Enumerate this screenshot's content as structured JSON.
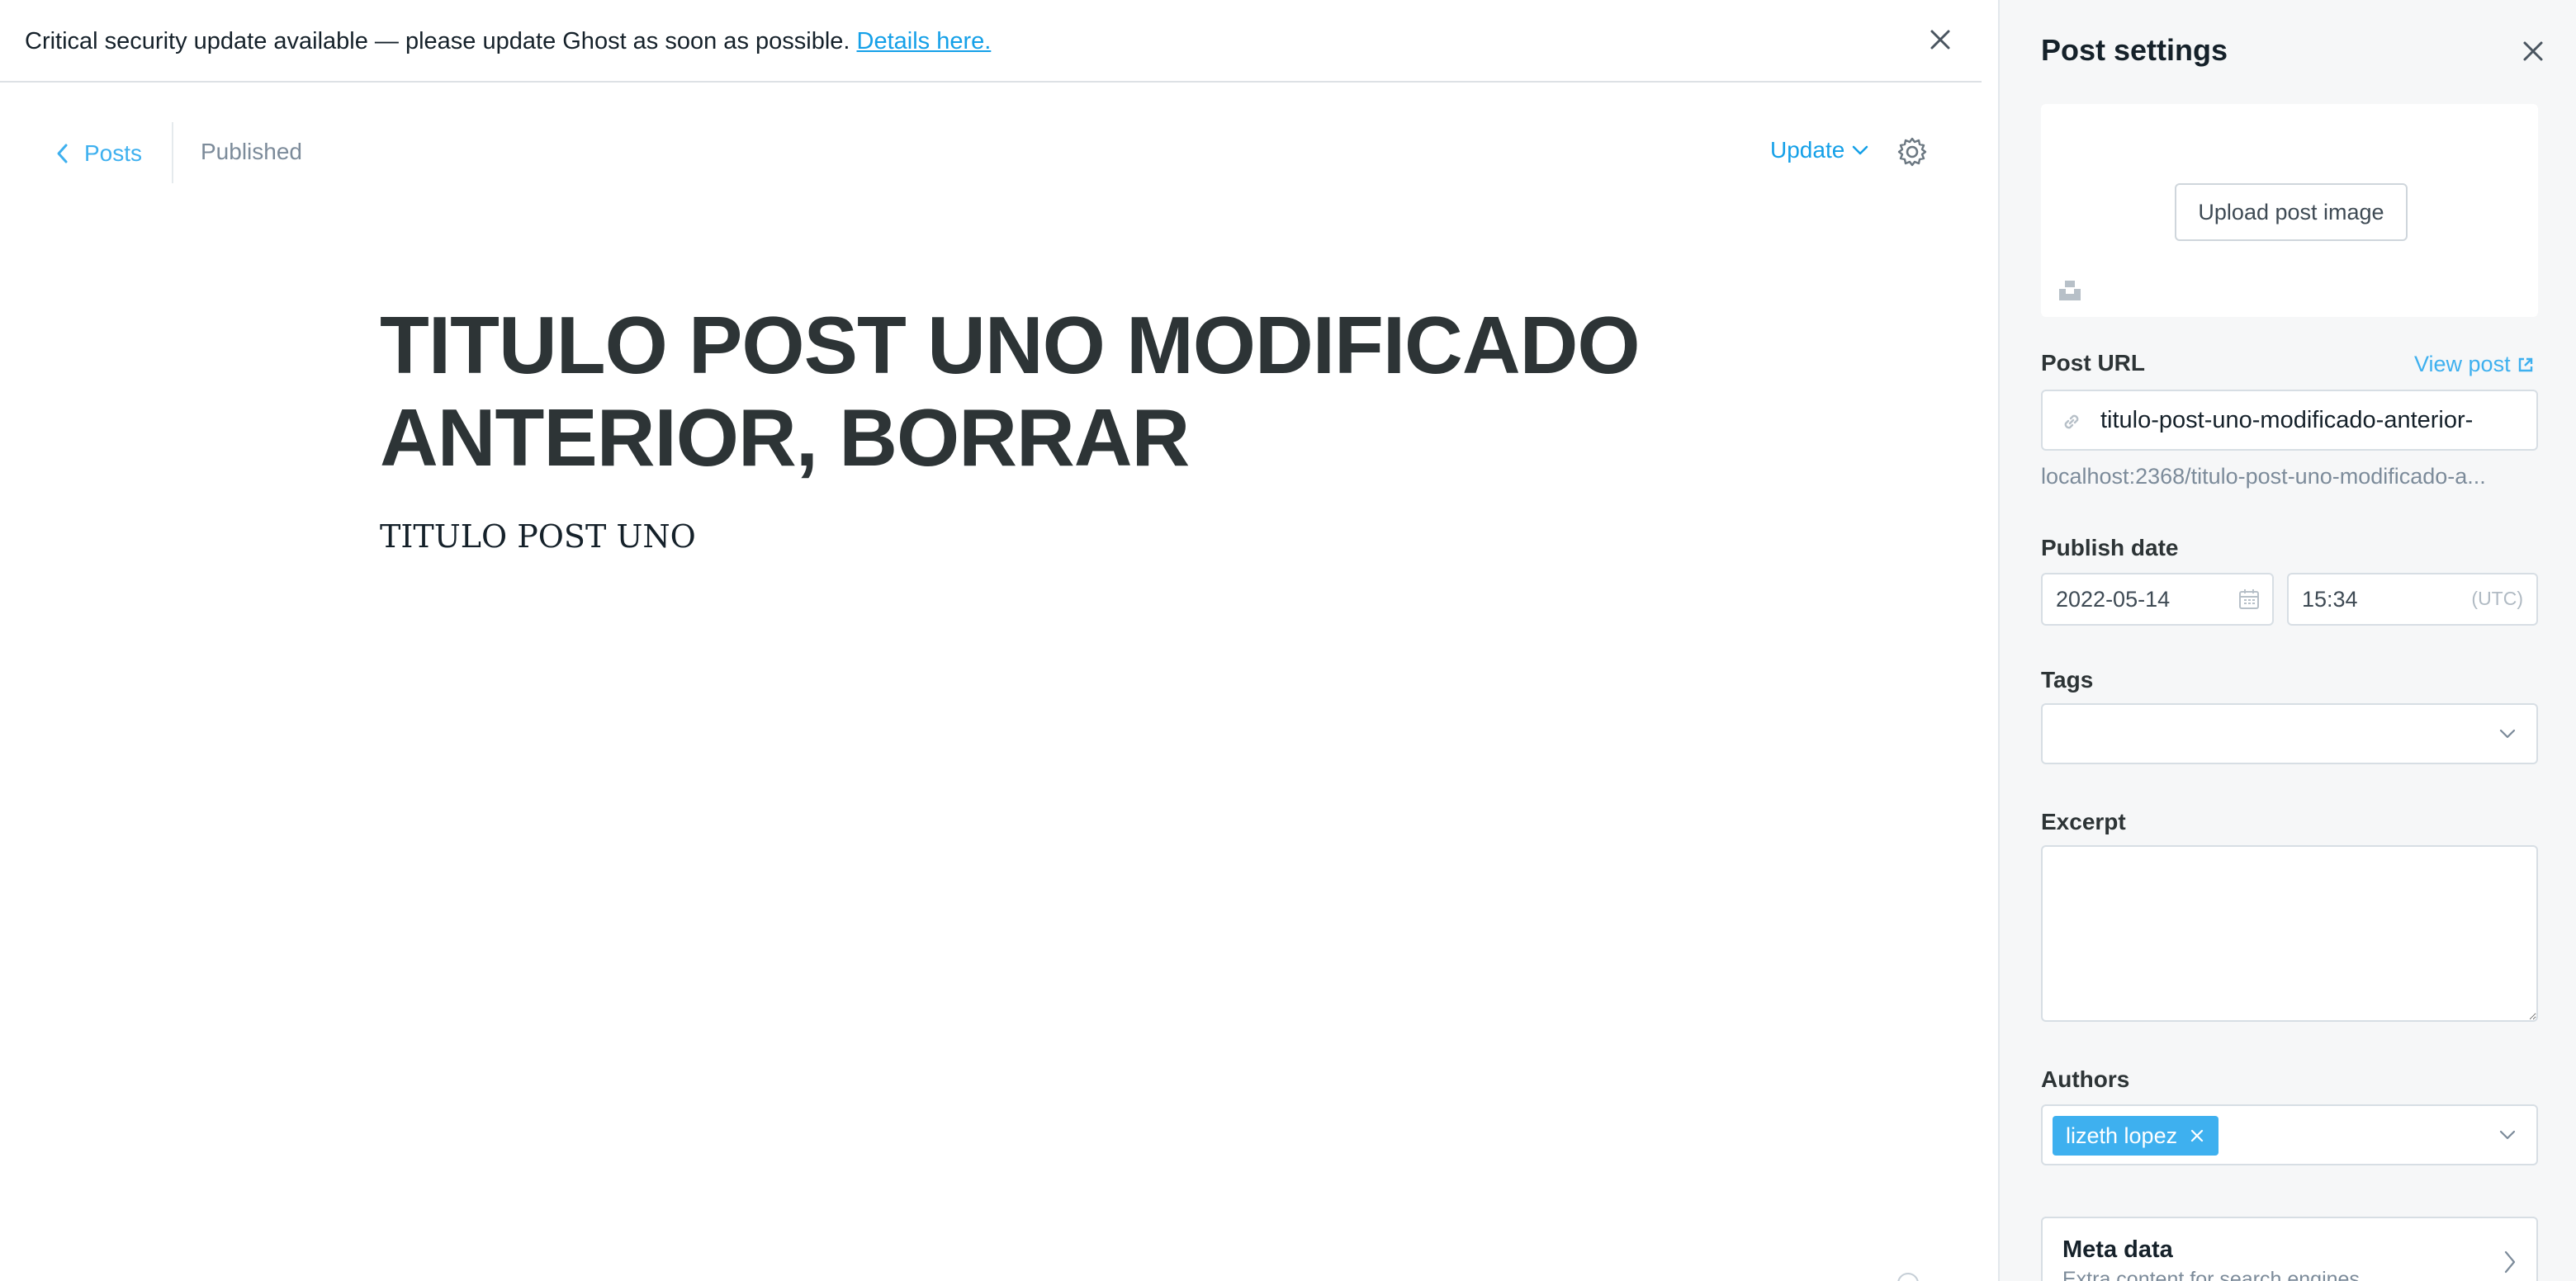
{
  "alert": {
    "message": "Critical security update available — please update Ghost as soon as possible.",
    "link_text": "Details here."
  },
  "nav": {
    "back_label": "Posts",
    "status": "Published",
    "update_label": "Update"
  },
  "post": {
    "title": "TITULO POST UNO MODIFICADO ANTERIOR, BORRAR",
    "body": "TITULO POST UNO"
  },
  "settings": {
    "title": "Post settings",
    "upload_label": "Upload post image",
    "url": {
      "label": "Post URL",
      "view_link": "View post",
      "slug": "titulo-post-uno-modificado-anterior-",
      "full_url": "localhost:2368/titulo-post-uno-modificado-a..."
    },
    "publish_date": {
      "label": "Publish date",
      "date": "2022-05-14",
      "time": "15:34",
      "timezone": "(UTC)"
    },
    "tags": {
      "label": "Tags"
    },
    "excerpt": {
      "label": "Excerpt",
      "value": ""
    },
    "authors": {
      "label": "Authors",
      "items": [
        "lizeth lopez"
      ]
    },
    "meta": {
      "title": "Meta data",
      "subtitle": "Extra content for search engines"
    }
  },
  "colors": {
    "accent": "#3eb0ef",
    "link": "#14a0e8",
    "panel_bg": "#f6f7f8",
    "text": "#15212a"
  },
  "icons": [
    "close-icon",
    "chevron-left-icon",
    "chevron-down-icon",
    "gear-icon",
    "unsplash-icon",
    "link-icon",
    "external-link-icon",
    "calendar-icon",
    "chevron-right-icon"
  ]
}
